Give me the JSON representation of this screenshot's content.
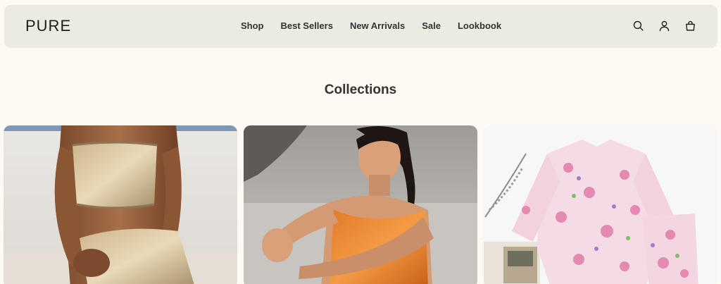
{
  "brand": {
    "logo_text": "PURE"
  },
  "nav": {
    "items": [
      {
        "label": "Shop"
      },
      {
        "label": "Best Sellers"
      },
      {
        "label": "New Arrivals"
      },
      {
        "label": "Sale"
      },
      {
        "label": "Lookbook"
      }
    ]
  },
  "header_icons": [
    "search-icon",
    "account-icon",
    "cart-bag-icon"
  ],
  "collections": {
    "title": "Collections",
    "cards": [
      {
        "image": "model-in-metallic-sequin-set"
      },
      {
        "image": "woman-in-orange-sports-top-stretching"
      },
      {
        "image": "floral-pink-robe-flatlay"
      }
    ]
  },
  "colors": {
    "page_bg": "#fcfaf2",
    "header_bg": "#ecebe1",
    "text": "#2b2b2b"
  }
}
